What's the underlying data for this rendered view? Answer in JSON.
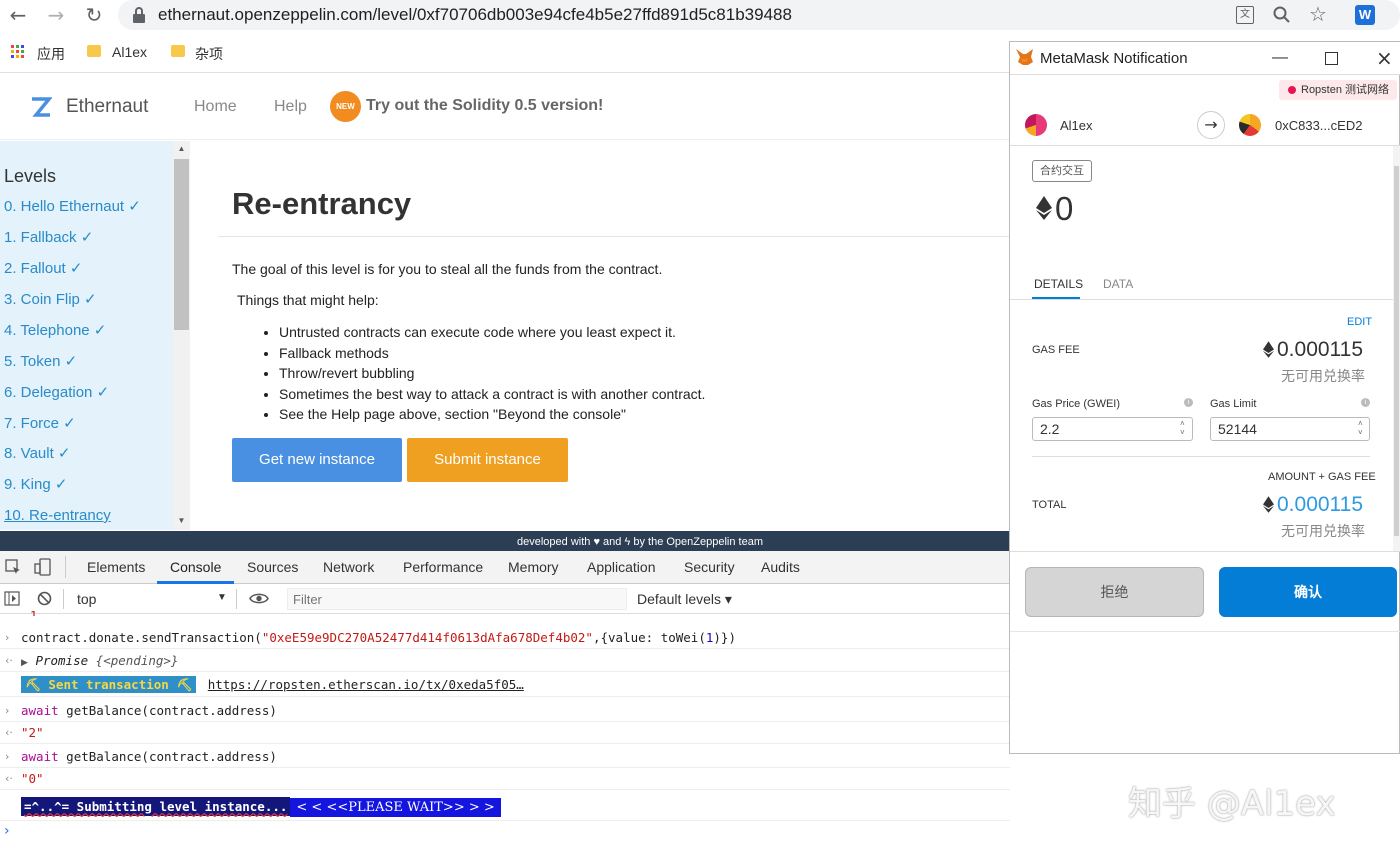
{
  "browser": {
    "url": "ethernaut.openzeppelin.com/level/0xf70706db003e94cfe4b5e27ffd891d5c81b39488",
    "bookmarks": [
      "应用",
      "Al1ex",
      "杂项"
    ]
  },
  "header": {
    "brand": "Ethernaut",
    "nav": [
      "Home",
      "Help"
    ],
    "badge": "NEW",
    "promo": "Try out the Solidity 0.5 version!"
  },
  "sidebar": {
    "title": "Levels",
    "items": [
      "0. Hello Ethernaut ✓",
      "1. Fallback ✓",
      "2. Fallout ✓",
      "3. Coin Flip ✓",
      "4. Telephone ✓",
      "5. Token ✓",
      "6. Delegation ✓",
      "7. Force ✓",
      "8. Vault ✓",
      "9. King ✓",
      "10. Re-entrancy"
    ]
  },
  "level": {
    "title": "Re-entrancy",
    "goal": "The goal of this level is for you to steal all the funds from the contract.",
    "hints_title": "Things that might help:",
    "hints": [
      "Untrusted contracts can execute code where you least expect it.",
      "Fallback methods",
      "Throw/revert bubbling",
      "Sometimes the best way to attack a contract is with another contract.",
      "See the Help page above, section \"Beyond the console\""
    ],
    "get_instance": "Get new instance",
    "submit_instance": "Submit instance"
  },
  "footer": {
    "pre": "developed with",
    "mid": "and",
    "post": "by the OpenZeppelin team"
  },
  "devtools": {
    "tabs": [
      "Elements",
      "Console",
      "Sources",
      "Network",
      "Performance",
      "Memory",
      "Application",
      "Security",
      "Audits"
    ],
    "context": "top",
    "filter_placeholder": "Filter",
    "levels": "Default levels ▾",
    "console": {
      "cut": "1",
      "l1_pre": "contract.donate.sendTransaction(",
      "l1_str": "\"0xeE59e9DC270A52477d414f0613dAfa678Def4b02\"",
      "l1_mid": ",{value: toWei(",
      "l1_num": "1",
      "l1_end": ")})",
      "promise": "Promise",
      "pending": "{<pending>}",
      "sent": "⛏ Sent transaction ⛏",
      "tx_link": "https://ropsten.etherscan.io/tx/0xeda5f05…",
      "await": "await",
      "call": " getBalance(contract.address)",
      "r1": "\"2\"",
      "r2": "\"0\"",
      "submitting": "=^..^= Submitting level instance...",
      "wait": "<  < <<PLEASE WAIT>> >  >"
    }
  },
  "metamask": {
    "title": "MetaMask Notification",
    "network": "Ropsten 测试网络",
    "from": "Al1ex",
    "to": "0xC833...cED2",
    "tag": "合约交互",
    "amount": "0",
    "tabs": [
      "DETAILS",
      "DATA"
    ],
    "edit": "EDIT",
    "gas_fee_label": "GAS FEE",
    "gas_fee": "0.000115",
    "no_rate": "无可用兑换率",
    "gas_price_label": "Gas Price (GWEI)",
    "gas_price": "2.2",
    "gas_limit_label": "Gas Limit",
    "gas_limit": "52144",
    "amount_gas_label": "AMOUNT + GAS FEE",
    "total_label": "TOTAL",
    "total": "0.000115",
    "reject": "拒绝",
    "confirm": "确认"
  },
  "watermark": "知乎 @Al1ex",
  "colors": {
    "accent": "#4a90e2",
    "submit": "#f0a020",
    "mmblue": "#037dd6"
  }
}
